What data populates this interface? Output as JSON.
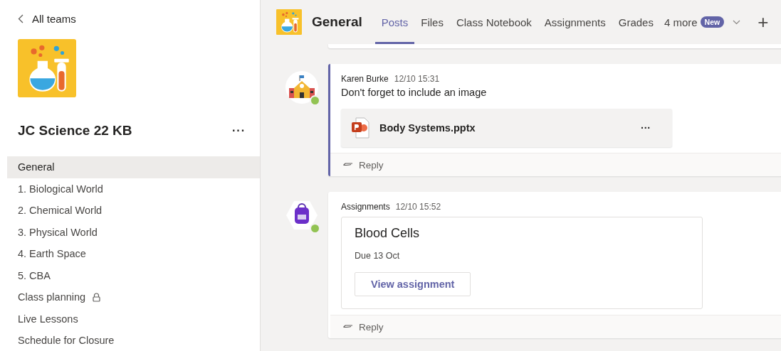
{
  "sidebar": {
    "back_link": "All teams",
    "team_name": "JC Science 22 KB",
    "more_menu": "···",
    "channels": [
      {
        "name": "General",
        "selected": true,
        "private": false
      },
      {
        "name": "1. Biological World",
        "selected": false,
        "private": false
      },
      {
        "name": "2. Chemical World",
        "selected": false,
        "private": false
      },
      {
        "name": "3. Physical World",
        "selected": false,
        "private": false
      },
      {
        "name": "4. Earth Space",
        "selected": false,
        "private": false
      },
      {
        "name": "5. CBA",
        "selected": false,
        "private": false
      },
      {
        "name": "Class planning",
        "selected": false,
        "private": true
      },
      {
        "name": "Live Lessons",
        "selected": false,
        "private": false
      },
      {
        "name": "Schedule for Closure",
        "selected": false,
        "private": false
      }
    ]
  },
  "header": {
    "channel_name": "General",
    "tabs": [
      {
        "label": "Posts",
        "selected": true
      },
      {
        "label": "Files",
        "selected": false
      },
      {
        "label": "Class Notebook",
        "selected": false
      },
      {
        "label": "Assignments",
        "selected": false
      },
      {
        "label": "Grades",
        "selected": false
      }
    ],
    "more_tabs": {
      "label": "4 more",
      "badge": "New"
    },
    "add_tab": "+"
  },
  "messages": [
    {
      "kind": "post",
      "author": "Karen Burke",
      "time": "12/10 15:31",
      "text": "Don't forget to include an image",
      "highlighted": true,
      "online": true,
      "attachment": {
        "name": "Body Systems.pptx",
        "menu": "···"
      },
      "reply": "Reply"
    },
    {
      "kind": "assignment",
      "author": "Assignments",
      "time": "12/10 15:52",
      "highlighted": false,
      "online": true,
      "assignment": {
        "title": "Blood Cells",
        "due": "Due 13 Oct",
        "button": "View assignment"
      },
      "reply": "Reply"
    }
  ]
}
